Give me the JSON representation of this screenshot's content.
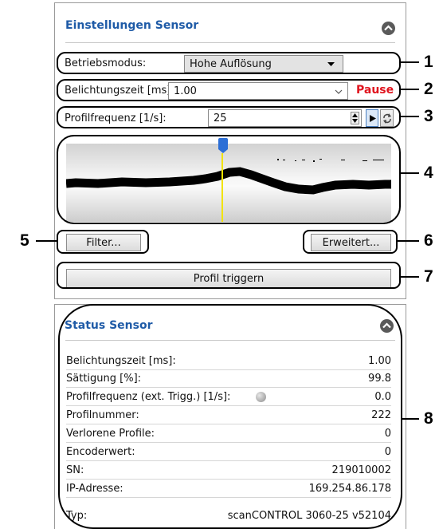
{
  "settings_panel": {
    "title": "Einstellungen Sensor",
    "operating_mode": {
      "label": "Betriebsmodus:",
      "value": "Hohe Auflösung"
    },
    "exposure_time": {
      "label": "Belichtungszeit [ms]:",
      "value": "1.00",
      "pause_label": "Pause"
    },
    "profile_frequency": {
      "label": "Profilfrequenz [1/s]:",
      "value": "25"
    },
    "filter_button": "Filter...",
    "extended_button": "Erweitert...",
    "trigger_button": "Profil triggern"
  },
  "status_panel": {
    "title": "Status Sensor",
    "rows": [
      {
        "label": "Belichtungszeit [ms]:",
        "value": "1.00"
      },
      {
        "label": "Sättigung [%]:",
        "value": "99.8"
      },
      {
        "label": "Profilfrequenz (ext. Trigg.) [1/s]:",
        "value": "0.0"
      },
      {
        "label": "Profilnummer:",
        "value": "222"
      },
      {
        "label": "Verlorene Profile:",
        "value": "0"
      },
      {
        "label": "Encoderwert:",
        "value": "0"
      },
      {
        "label": "SN:",
        "value": "219010002"
      },
      {
        "label": "IP-Adresse:",
        "value": "169.254.86.178"
      },
      {
        "label": "Typ:",
        "value": "scanCONTROL 3060-25 v52104"
      }
    ]
  },
  "callouts": [
    "1",
    "2",
    "3",
    "4",
    "5",
    "6",
    "7",
    "8"
  ],
  "colors": {
    "title_blue": "#1f5ba7",
    "pause_red": "#e0141e",
    "marker_blue": "#2d6fd6",
    "trace_yellow": "#f2e300"
  }
}
